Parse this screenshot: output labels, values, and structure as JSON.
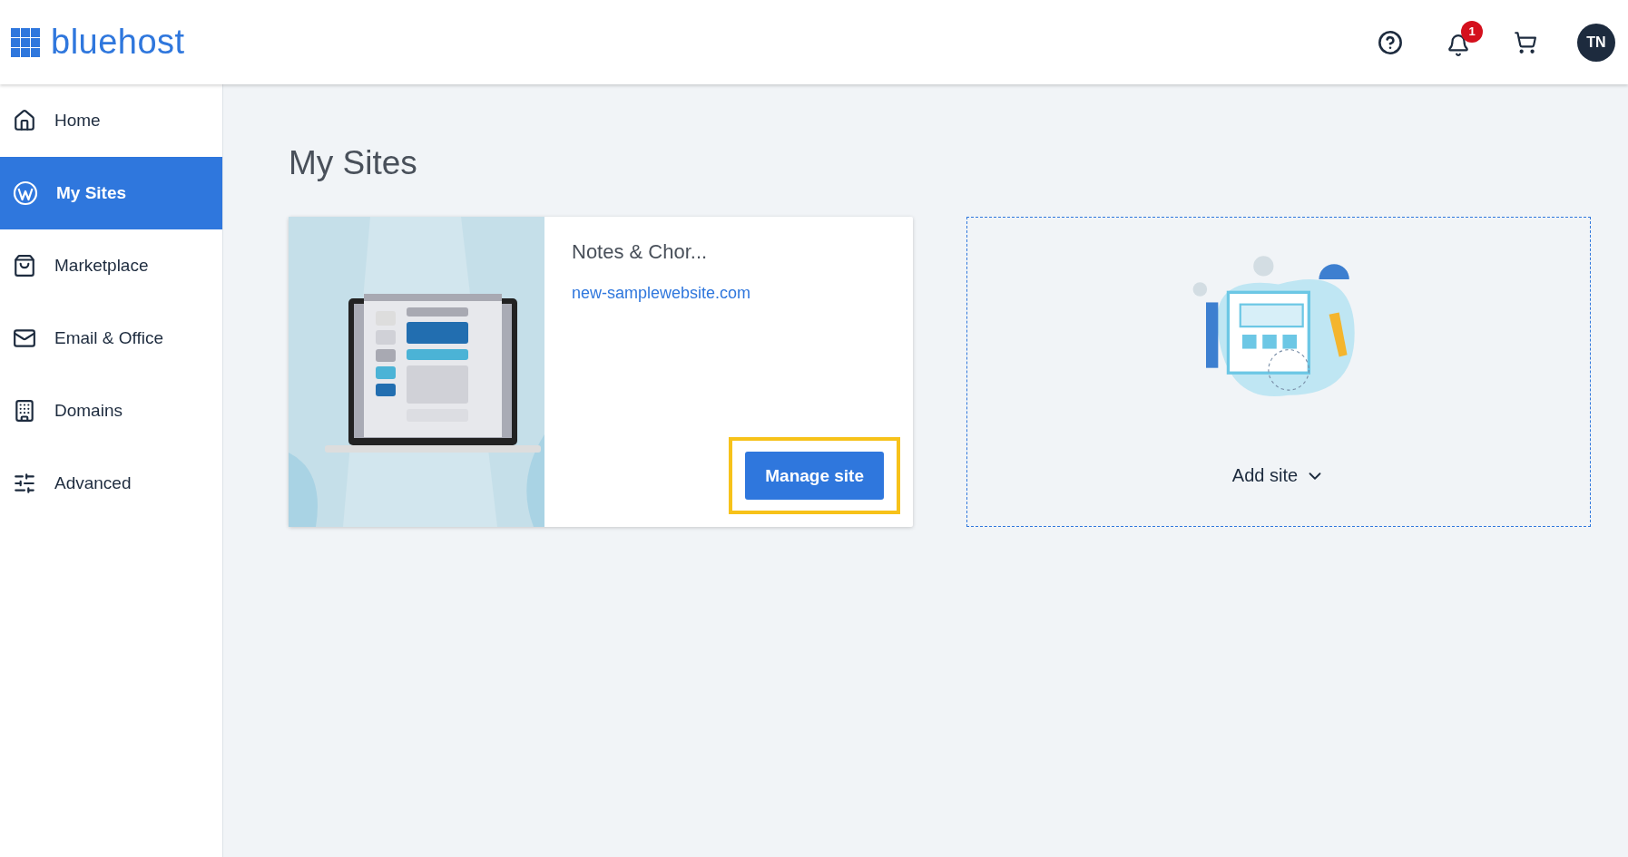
{
  "header": {
    "logo": "bluehost",
    "notifications_badge": "1",
    "avatar": "TN"
  },
  "sidebar": {
    "items": [
      {
        "label": "Home",
        "selected": false
      },
      {
        "label": "My Sites",
        "selected": true
      },
      {
        "label": "Marketplace",
        "selected": false
      },
      {
        "label": "Email & Office",
        "selected": false
      },
      {
        "label": "Domains",
        "selected": false
      },
      {
        "label": "Advanced",
        "selected": false
      }
    ]
  },
  "page_title": "My Sites",
  "sites": [
    {
      "name": "Notes & Chor...",
      "url": "new-samplewebsite.com",
      "button": {
        "label": "Manage site",
        "highlighted": true
      }
    }
  ],
  "add_site": {
    "label": "Add site"
  }
}
